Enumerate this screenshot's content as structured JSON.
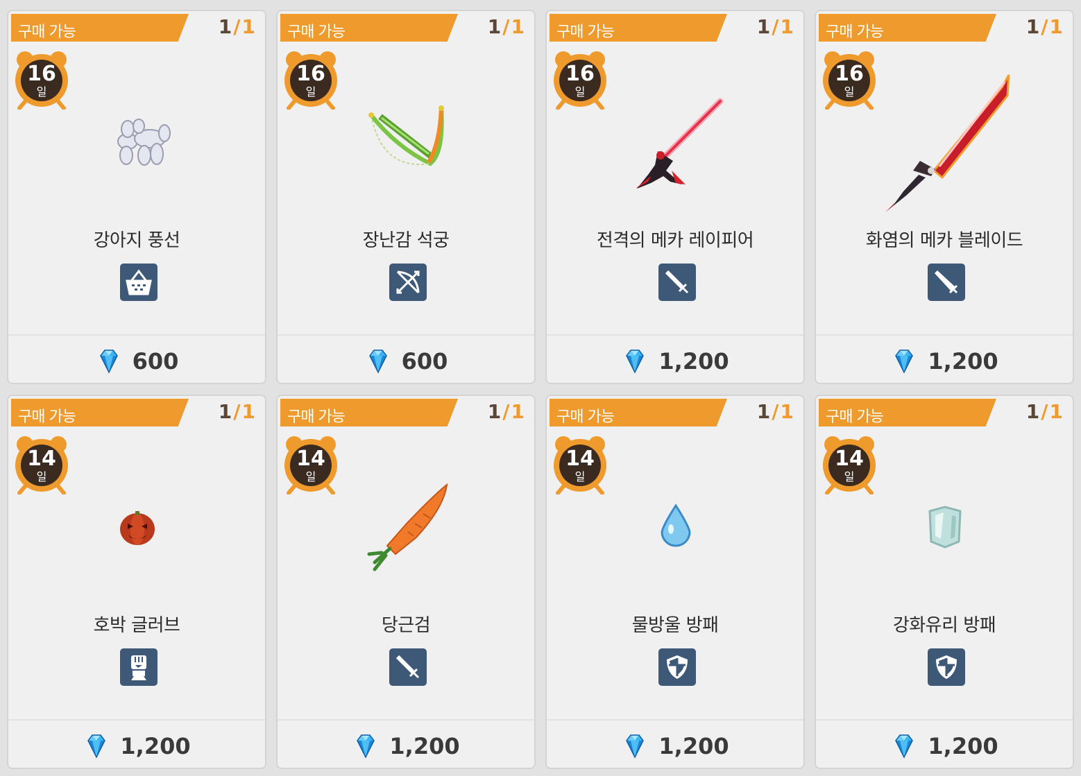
{
  "cards": [
    {
      "badge": "구매 가능",
      "stock_current": "1",
      "stock_max": "1",
      "days": "16",
      "days_unit": "일",
      "name": "강아지 풍선",
      "category_icon": "basket-icon",
      "item_icon": "balloon-dog-icon",
      "currency_icon": "diamond-icon",
      "price": "600"
    },
    {
      "badge": "구매 가능",
      "stock_current": "1",
      "stock_max": "1",
      "days": "16",
      "days_unit": "일",
      "name": "장난감 석궁",
      "category_icon": "bow-icon",
      "item_icon": "crossbow-icon",
      "currency_icon": "diamond-icon",
      "price": "600"
    },
    {
      "badge": "구매 가능",
      "stock_current": "1",
      "stock_max": "1",
      "days": "16",
      "days_unit": "일",
      "name": "전격의 메카 레이피어",
      "category_icon": "sword-icon",
      "item_icon": "rapier-icon",
      "currency_icon": "diamond-icon",
      "price": "1,200"
    },
    {
      "badge": "구매 가능",
      "stock_current": "1",
      "stock_max": "1",
      "days": "16",
      "days_unit": "일",
      "name": "화염의 메카 블레이드",
      "category_icon": "greatsword-icon",
      "item_icon": "blade-icon",
      "currency_icon": "diamond-icon",
      "price": "1,200"
    },
    {
      "badge": "구매 가능",
      "stock_current": "1",
      "stock_max": "1",
      "days": "14",
      "days_unit": "일",
      "name": "호박 글러브",
      "category_icon": "fist-icon",
      "item_icon": "pumpkin-icon",
      "currency_icon": "diamond-icon",
      "price": "1,200"
    },
    {
      "badge": "구매 가능",
      "stock_current": "1",
      "stock_max": "1",
      "days": "14",
      "days_unit": "일",
      "name": "당근검",
      "category_icon": "sword-icon",
      "item_icon": "carrot-icon",
      "currency_icon": "diamond-icon",
      "price": "1,200"
    },
    {
      "badge": "구매 가능",
      "stock_current": "1",
      "stock_max": "1",
      "days": "14",
      "days_unit": "일",
      "name": "물방울 방패",
      "category_icon": "shield-icon",
      "item_icon": "water-drop-icon",
      "currency_icon": "diamond-icon",
      "price": "1,200"
    },
    {
      "badge": "구매 가능",
      "stock_current": "1",
      "stock_max": "1",
      "days": "14",
      "days_unit": "일",
      "name": "강화유리 방패",
      "category_icon": "shield-icon",
      "item_icon": "glass-shield-icon",
      "currency_icon": "diamond-icon",
      "price": "1,200"
    }
  ],
  "colors": {
    "badge": "#ee9a2c",
    "category_icon_bg": "#3e5977",
    "clock": "#ee9a2c",
    "clock_face": "#3b2a1f"
  }
}
